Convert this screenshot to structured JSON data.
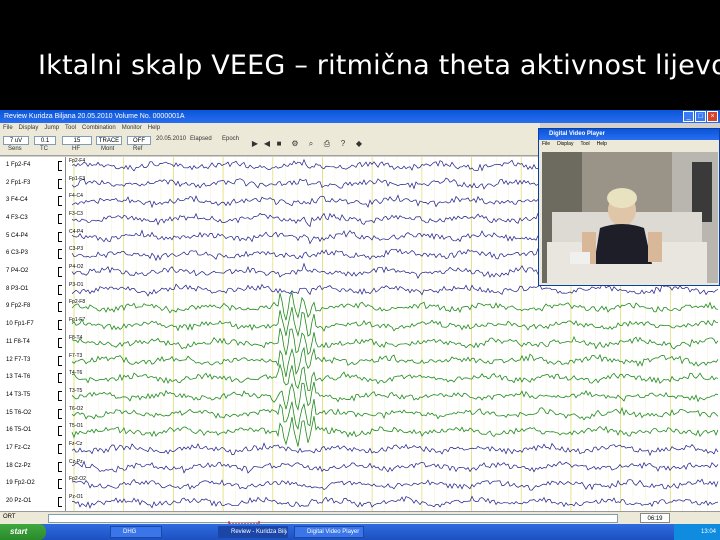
{
  "slide": {
    "title": "Iktalni skalp VEEG – ritmična theta aktivnost lijevo"
  },
  "app": {
    "title": "Review  Kuridza Biljana    20.05.2010    Volume No. 0000001A",
    "menu": [
      "File",
      "Display",
      "Jump",
      "Tool",
      "Combination",
      "Monitor",
      "Help"
    ],
    "toolbar": {
      "sens_value": "7 uV",
      "sens_label": "Sens",
      "tc_value": "0.1",
      "tc_label": "TC",
      "hf_value": "15",
      "hf_label": "HF",
      "trace_value": "TRACE",
      "trace_label": "Mont",
      "off_value": "OFF",
      "off_label": "Ref",
      "date": "20.05.2010",
      "elapsed_label": "Elapsed",
      "epoch_label": "Epoch"
    },
    "channels": [
      "Fp2-F4",
      "Fp1-F3",
      "F4-C4",
      "F3-C3",
      "C4-P4",
      "C3-P3",
      "P4-O2",
      "P3-O1",
      "Fp2-F8",
      "Fp1-F7",
      "F8-T4",
      "F7-T3",
      "T4-T6",
      "T3-T5",
      "T6-O2",
      "T5-O1",
      "Fz-Cz",
      "Cz-Pz",
      "Fp2-O2",
      "Pz-O1"
    ],
    "channel_numbers": [
      "1",
      "2",
      "3",
      "4",
      "5",
      "6",
      "7",
      "8",
      "9",
      "10",
      "11",
      "12",
      "13",
      "14",
      "15",
      "16",
      "17",
      "18",
      "19",
      "20"
    ],
    "page_indicator": "ORT",
    "scroll_position": "06:19",
    "colors": {
      "trace_blue": "#1a1a8a",
      "trace_green": "#1f8a1f",
      "grid_yellow": "#d8d040"
    }
  },
  "taskbar": {
    "start": "start",
    "items": [
      "DHG",
      "Review - Kuridza Bilja...",
      "Digital Video Player"
    ],
    "clock": "13:04"
  },
  "video_player": {
    "title": "Digital Video Player",
    "menu": [
      "File",
      "Display",
      "Tool",
      "Help"
    ]
  }
}
